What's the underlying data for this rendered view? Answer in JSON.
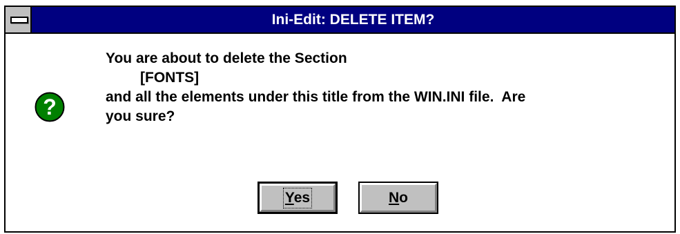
{
  "window": {
    "title": "Ini-Edit: DELETE ITEM?"
  },
  "icon": {
    "name": "question-icon",
    "glyph": "?",
    "color": "#008000"
  },
  "message": {
    "line1": "You are about to delete the Section",
    "line2": "[FONTS]",
    "line3": "and all the elements under this title from the WIN.INI file.  Are",
    "line4": "you sure?"
  },
  "buttons": {
    "yes": {
      "mnemonic": "Y",
      "rest": "es"
    },
    "no": {
      "mnemonic": "N",
      "rest": "o"
    }
  },
  "colors": {
    "titlebar": "#000080",
    "button_face": "#c0c0c0"
  }
}
